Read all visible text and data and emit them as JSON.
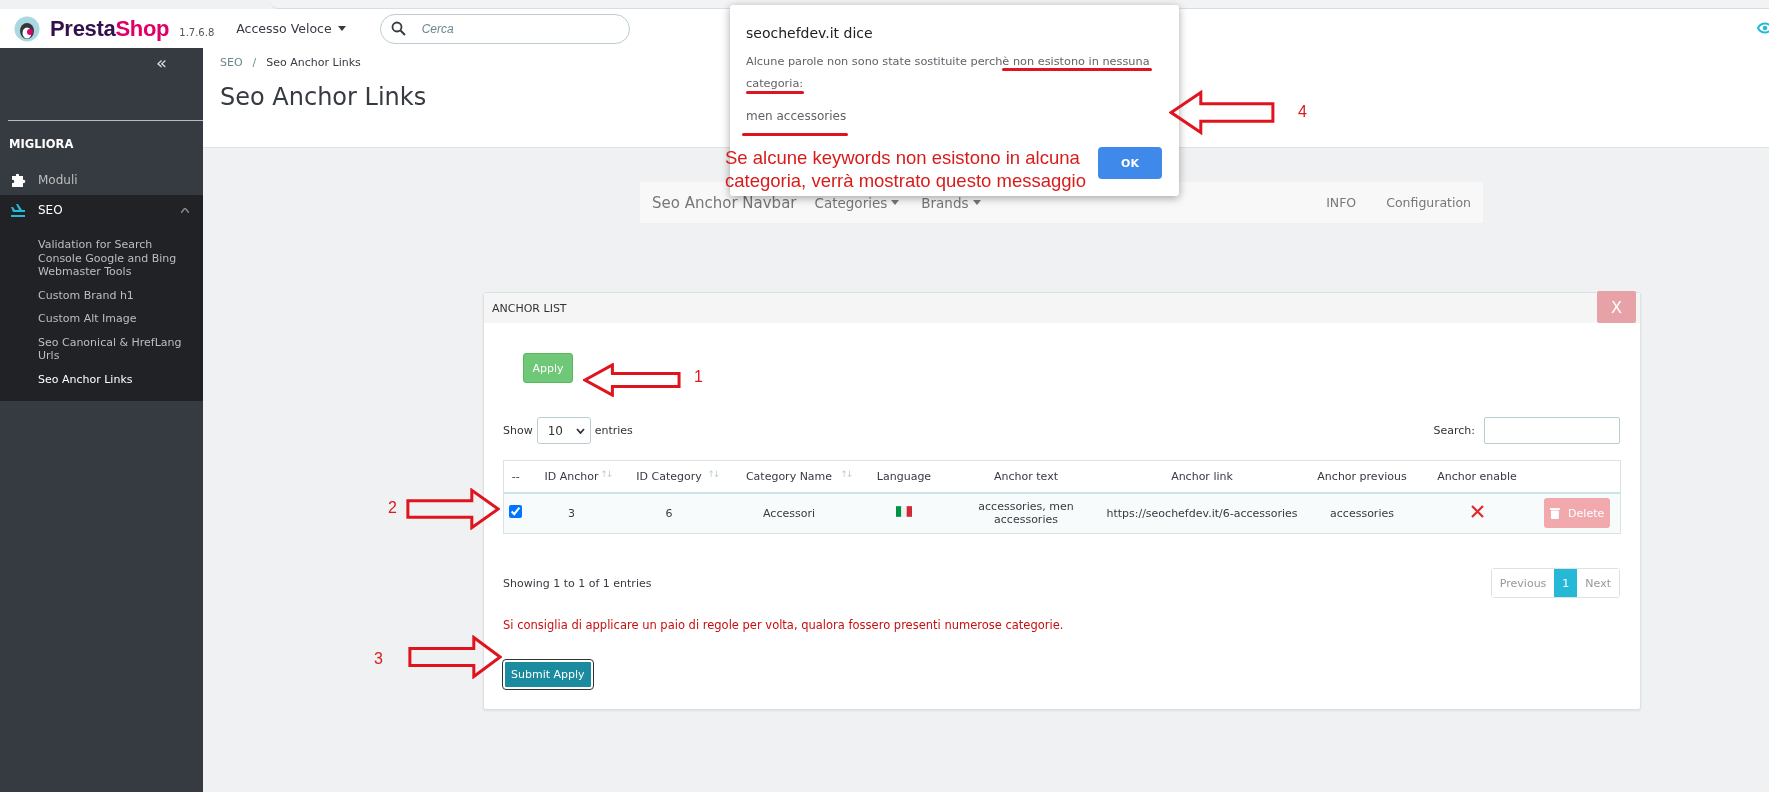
{
  "header": {
    "logo_parts": [
      "Presta",
      "Shop"
    ],
    "version": "1.7.6.8",
    "quick_access": "Accesso Veloce",
    "search": {
      "placeholder": "Cerca"
    }
  },
  "sidebar": {
    "collapse": "«",
    "section": "MIGLIORA",
    "items": [
      {
        "label": "Moduli",
        "selected": false
      },
      {
        "label": "SEO",
        "selected": true,
        "children": [
          {
            "label": "Validation for Search Console Google and Bing Webmaster Tools",
            "selected": false
          },
          {
            "label": "Custom Brand h1",
            "selected": false
          },
          {
            "label": "Custom Alt Image",
            "selected": false
          },
          {
            "label": "Seo Canonical & HrefLang Urls",
            "selected": false
          },
          {
            "label": "Seo Anchor Links",
            "selected": true
          }
        ]
      }
    ]
  },
  "breadcrumb": [
    "SEO",
    "Seo Anchor Links"
  ],
  "breadcrumb_separator": "/",
  "page_title": "Seo Anchor Links",
  "navbar": {
    "brand": "Seo Anchor Navbar",
    "menus": [
      "Categories",
      "Brands"
    ],
    "links": [
      "INFO",
      "Configuration"
    ]
  },
  "panel": {
    "title": "ANCHOR LIST",
    "close": "X",
    "apply": "Apply",
    "show_label": "Show",
    "page_length": "10",
    "entries_label": "entries",
    "search_label": "Search:",
    "columns": [
      {
        "label": "--"
      },
      {
        "label": "ID Anchor",
        "sort_icon": "↑↓"
      },
      {
        "label": "ID Category",
        "sort_icon": "↑↓"
      },
      {
        "label": "Category Name",
        "sort_icon": "↑↓"
      },
      {
        "label": "Language"
      },
      {
        "label": "Anchor text"
      },
      {
        "label": "Anchor link"
      },
      {
        "label": "Anchor previous"
      },
      {
        "label": "Anchor enable"
      },
      {}
    ],
    "rows": [
      {
        "checked": true,
        "id_anchor": "3",
        "id_category": "6",
        "category_name": "Accessori",
        "anchor_text": "accessories, men accessories",
        "anchor_link": "https://seochefdev.it/6-accessories",
        "anchor_previous": "accessories",
        "enabled": false,
        "delete": "Delete"
      }
    ],
    "info": "Showing 1 to 1 of 1 entries",
    "pagination": {
      "previous": "Previous",
      "pages": [
        {
          "label": "1",
          "selected": true
        }
      ],
      "next": "Next"
    },
    "notice": "Si consiglia di applicare un paio di regole per volta, qualora fossero presenti numerose categorie.",
    "submit": "Submit Apply"
  },
  "dialog": {
    "title": "seochefdev.it dice",
    "message": "Alcune parole non sono state sostituite perchè non esistono in nessuna categoria:",
    "detail": "men accessories",
    "ok": "OK"
  },
  "annotations": [
    {
      "number": "1"
    },
    {
      "number": "2"
    },
    {
      "number": "3"
    },
    {
      "number": "4"
    }
  ],
  "caption_lines": [
    "Se alcune keywords non esistono in alcuna",
    "categoria, verrà mostrato questo messaggio"
  ]
}
